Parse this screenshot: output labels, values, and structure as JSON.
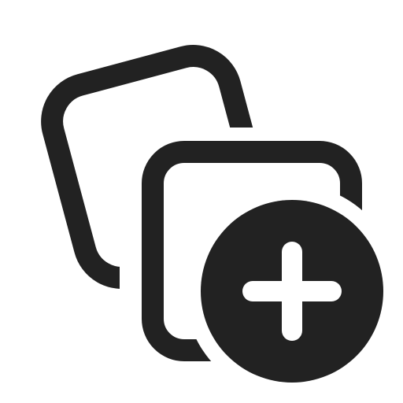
{
  "icon": {
    "name": "collections-add-icon",
    "description_components": [
      "back-card-icon",
      "front-card-icon",
      "plus-circle-icon",
      "plus-sign-icon"
    ]
  },
  "colors": {
    "background": "#ffffff",
    "foreground": "#222222",
    "plus_symbol": "#ffffff"
  }
}
